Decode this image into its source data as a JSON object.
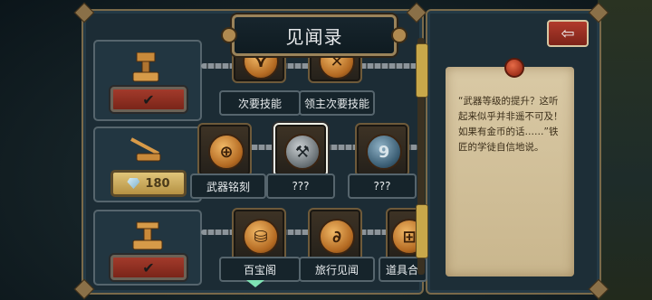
{
  "title": "见闻录",
  "back_button": {
    "icon": "back-arrow-icon"
  },
  "rows": [
    {
      "state": "unlocked",
      "check": "✔"
    },
    {
      "state": "locked",
      "cost": "180"
    },
    {
      "state": "unlocked",
      "check": "✔"
    }
  ],
  "skills": [
    {
      "label": "次要技能"
    },
    {
      "label": "领主次要技能"
    },
    {
      "label": "武器铭刻",
      "icon_text": "⊕"
    },
    {
      "label": "???",
      "icon_text": "⚒"
    },
    {
      "label": "???",
      "icon_text": "9"
    },
    {
      "label": "百宝阁",
      "icon_text": "⛁"
    },
    {
      "label": "旅行见闻",
      "icon_text": "∂"
    },
    {
      "label": "道具合",
      "icon_text": "⊞"
    }
  ],
  "description": "“武器等级的提升？这听起来似乎并非遥不可及！如果有金币的话……”铁匠的学徒自信地说。",
  "colors": {
    "accent_gold": "#c8a84a",
    "check_red": "#a33a2b",
    "panel": "#1c2c35"
  }
}
